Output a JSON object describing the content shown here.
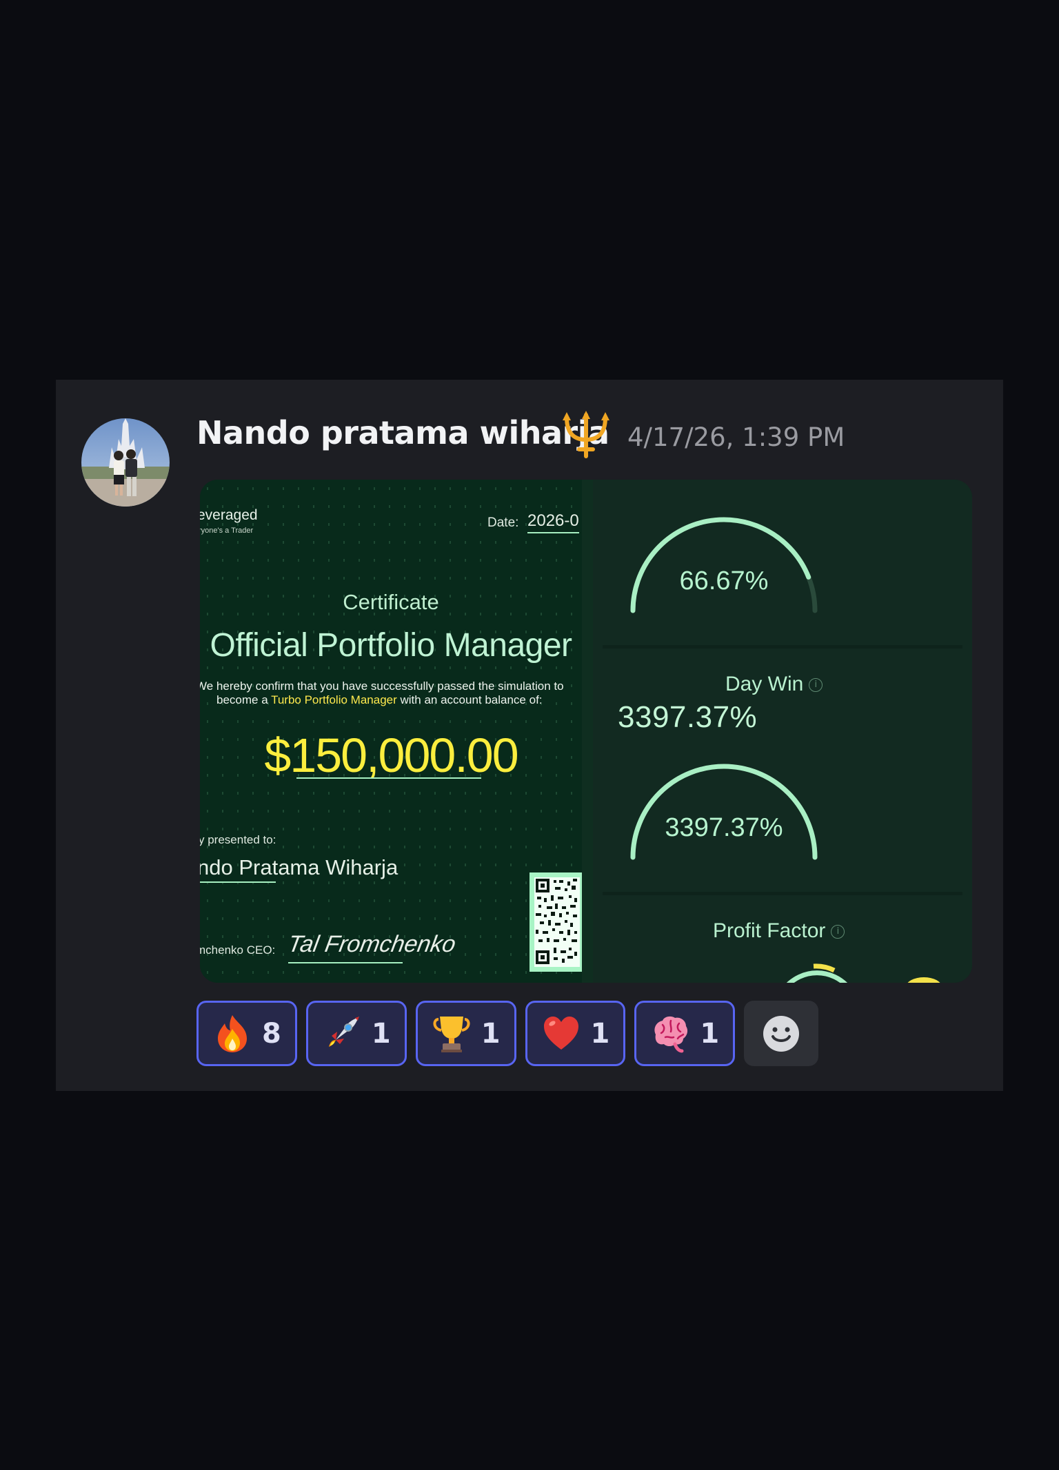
{
  "message": {
    "author": "Nando pratama wiharja",
    "timestamp": "4/17/26, 1:39 PM",
    "author_badge_icon": "trident-icon"
  },
  "certificate": {
    "brand": "everaged",
    "brand_tagline": "ryone's a Trader",
    "date_label": "Date:",
    "date_value": "2026-0",
    "kicker": "Certificate",
    "title": "Official Portfolio Manager",
    "confirm_line1": "We hereby confirm that you have successfully passed the simulation to",
    "confirm_line2_pre": "become a ",
    "confirm_line2_highlight": "Turbo Portfolio Manager",
    "confirm_line2_post": " with an account balance of:",
    "amount": "$150,000.00",
    "presented_to": "y presented to:",
    "recipient": "ndo Pratama Wiharja",
    "ceo_label": "mchenko CEO:",
    "signature": "Tal Fromchenko"
  },
  "stats": {
    "top_gauge": {
      "value": "66.67%",
      "fraction": 0.88
    },
    "day_win": {
      "label": "Day Win",
      "value": "3397.37%",
      "gauge_value": "3397.37%",
      "fraction": 1.0
    },
    "profit_factor": {
      "label": "Profit Factor"
    }
  },
  "reactions": [
    {
      "emoji": "fire-emoji",
      "count": "8"
    },
    {
      "emoji": "rocket-emoji",
      "count": "1"
    },
    {
      "emoji": "trophy-emoji",
      "count": "1"
    },
    {
      "emoji": "heart-emoji",
      "count": "1"
    },
    {
      "emoji": "brain-emoji",
      "count": "1"
    }
  ],
  "colors": {
    "accent": "#5865f2",
    "gauge": "#a9efc4",
    "cert_highlight": "#fbee3e"
  }
}
